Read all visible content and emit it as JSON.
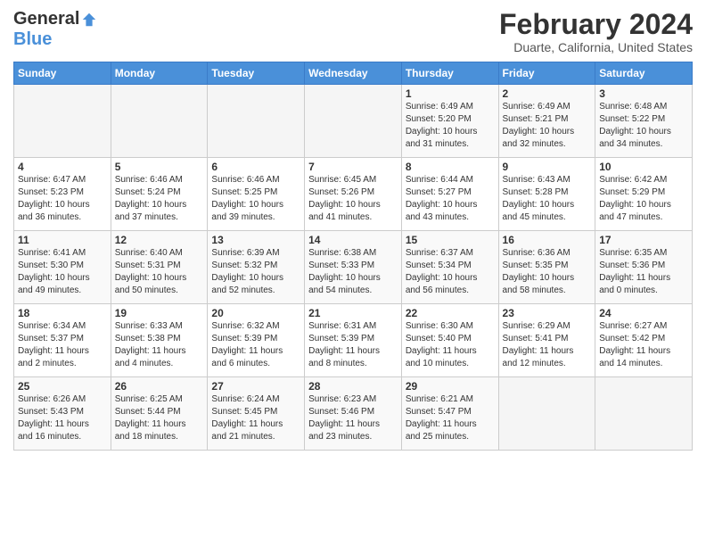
{
  "header": {
    "logo_general": "General",
    "logo_blue": "Blue",
    "title": "February 2024",
    "subtitle": "Duarte, California, United States"
  },
  "calendar": {
    "days_of_week": [
      "Sunday",
      "Monday",
      "Tuesday",
      "Wednesday",
      "Thursday",
      "Friday",
      "Saturday"
    ],
    "weeks": [
      [
        {
          "day": "",
          "content": ""
        },
        {
          "day": "",
          "content": ""
        },
        {
          "day": "",
          "content": ""
        },
        {
          "day": "",
          "content": ""
        },
        {
          "day": "1",
          "content": "Sunrise: 6:49 AM\nSunset: 5:20 PM\nDaylight: 10 hours\nand 31 minutes."
        },
        {
          "day": "2",
          "content": "Sunrise: 6:49 AM\nSunset: 5:21 PM\nDaylight: 10 hours\nand 32 minutes."
        },
        {
          "day": "3",
          "content": "Sunrise: 6:48 AM\nSunset: 5:22 PM\nDaylight: 10 hours\nand 34 minutes."
        }
      ],
      [
        {
          "day": "4",
          "content": "Sunrise: 6:47 AM\nSunset: 5:23 PM\nDaylight: 10 hours\nand 36 minutes."
        },
        {
          "day": "5",
          "content": "Sunrise: 6:46 AM\nSunset: 5:24 PM\nDaylight: 10 hours\nand 37 minutes."
        },
        {
          "day": "6",
          "content": "Sunrise: 6:46 AM\nSunset: 5:25 PM\nDaylight: 10 hours\nand 39 minutes."
        },
        {
          "day": "7",
          "content": "Sunrise: 6:45 AM\nSunset: 5:26 PM\nDaylight: 10 hours\nand 41 minutes."
        },
        {
          "day": "8",
          "content": "Sunrise: 6:44 AM\nSunset: 5:27 PM\nDaylight: 10 hours\nand 43 minutes."
        },
        {
          "day": "9",
          "content": "Sunrise: 6:43 AM\nSunset: 5:28 PM\nDaylight: 10 hours\nand 45 minutes."
        },
        {
          "day": "10",
          "content": "Sunrise: 6:42 AM\nSunset: 5:29 PM\nDaylight: 10 hours\nand 47 minutes."
        }
      ],
      [
        {
          "day": "11",
          "content": "Sunrise: 6:41 AM\nSunset: 5:30 PM\nDaylight: 10 hours\nand 49 minutes."
        },
        {
          "day": "12",
          "content": "Sunrise: 6:40 AM\nSunset: 5:31 PM\nDaylight: 10 hours\nand 50 minutes."
        },
        {
          "day": "13",
          "content": "Sunrise: 6:39 AM\nSunset: 5:32 PM\nDaylight: 10 hours\nand 52 minutes."
        },
        {
          "day": "14",
          "content": "Sunrise: 6:38 AM\nSunset: 5:33 PM\nDaylight: 10 hours\nand 54 minutes."
        },
        {
          "day": "15",
          "content": "Sunrise: 6:37 AM\nSunset: 5:34 PM\nDaylight: 10 hours\nand 56 minutes."
        },
        {
          "day": "16",
          "content": "Sunrise: 6:36 AM\nSunset: 5:35 PM\nDaylight: 10 hours\nand 58 minutes."
        },
        {
          "day": "17",
          "content": "Sunrise: 6:35 AM\nSunset: 5:36 PM\nDaylight: 11 hours\nand 0 minutes."
        }
      ],
      [
        {
          "day": "18",
          "content": "Sunrise: 6:34 AM\nSunset: 5:37 PM\nDaylight: 11 hours\nand 2 minutes."
        },
        {
          "day": "19",
          "content": "Sunrise: 6:33 AM\nSunset: 5:38 PM\nDaylight: 11 hours\nand 4 minutes."
        },
        {
          "day": "20",
          "content": "Sunrise: 6:32 AM\nSunset: 5:39 PM\nDaylight: 11 hours\nand 6 minutes."
        },
        {
          "day": "21",
          "content": "Sunrise: 6:31 AM\nSunset: 5:39 PM\nDaylight: 11 hours\nand 8 minutes."
        },
        {
          "day": "22",
          "content": "Sunrise: 6:30 AM\nSunset: 5:40 PM\nDaylight: 11 hours\nand 10 minutes."
        },
        {
          "day": "23",
          "content": "Sunrise: 6:29 AM\nSunset: 5:41 PM\nDaylight: 11 hours\nand 12 minutes."
        },
        {
          "day": "24",
          "content": "Sunrise: 6:27 AM\nSunset: 5:42 PM\nDaylight: 11 hours\nand 14 minutes."
        }
      ],
      [
        {
          "day": "25",
          "content": "Sunrise: 6:26 AM\nSunset: 5:43 PM\nDaylight: 11 hours\nand 16 minutes."
        },
        {
          "day": "26",
          "content": "Sunrise: 6:25 AM\nSunset: 5:44 PM\nDaylight: 11 hours\nand 18 minutes."
        },
        {
          "day": "27",
          "content": "Sunrise: 6:24 AM\nSunset: 5:45 PM\nDaylight: 11 hours\nand 21 minutes."
        },
        {
          "day": "28",
          "content": "Sunrise: 6:23 AM\nSunset: 5:46 PM\nDaylight: 11 hours\nand 23 minutes."
        },
        {
          "day": "29",
          "content": "Sunrise: 6:21 AM\nSunset: 5:47 PM\nDaylight: 11 hours\nand 25 minutes."
        },
        {
          "day": "",
          "content": ""
        },
        {
          "day": "",
          "content": ""
        }
      ]
    ]
  }
}
